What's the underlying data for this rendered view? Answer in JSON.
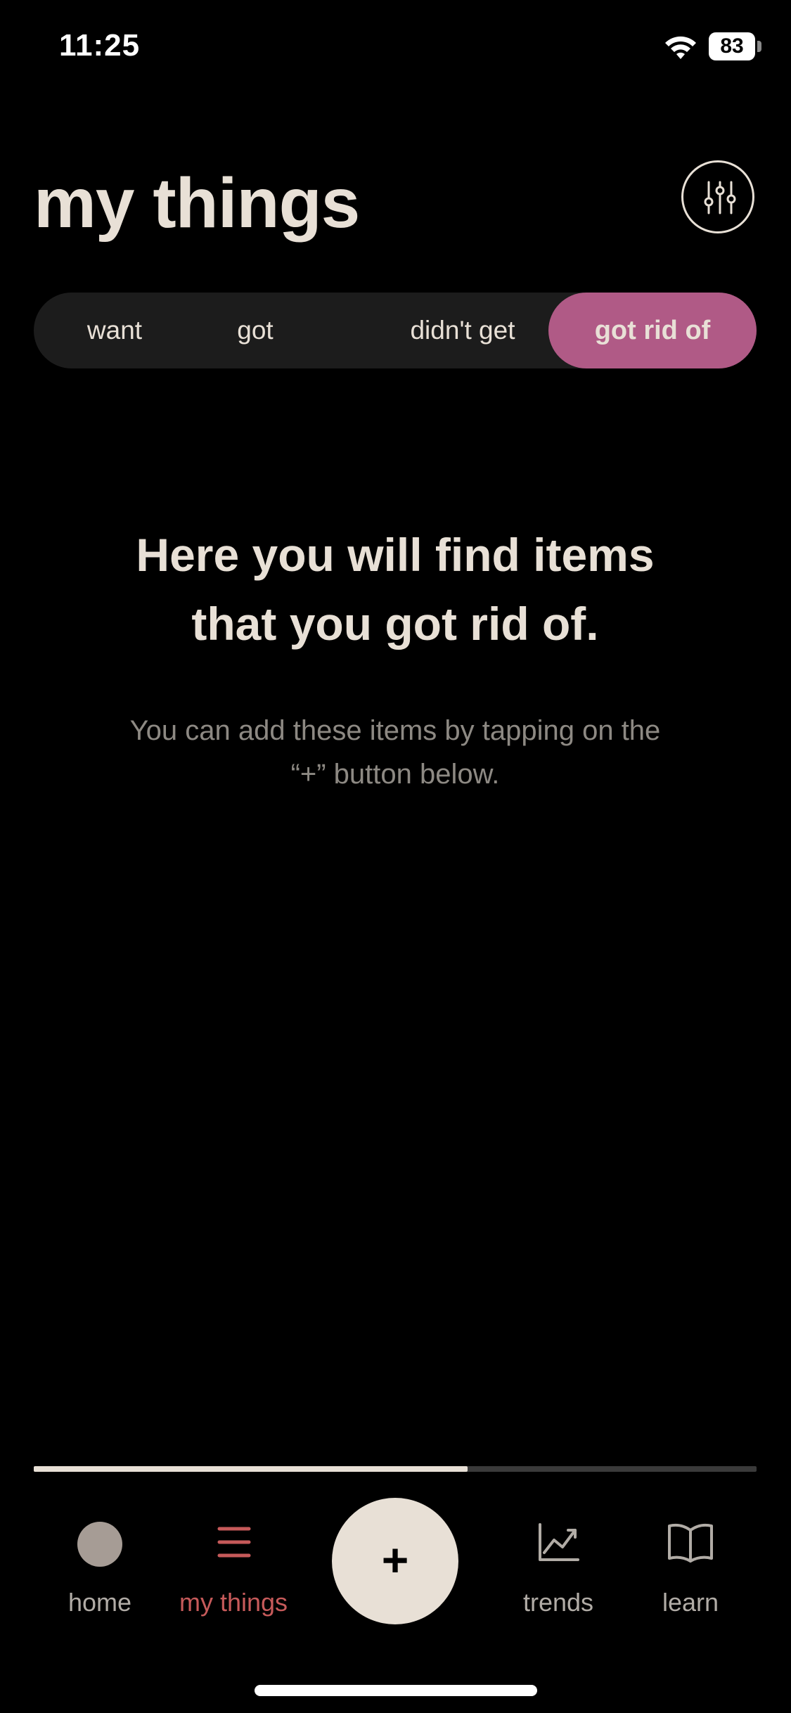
{
  "status_bar": {
    "time": "11:25",
    "battery": "83"
  },
  "header": {
    "title": "my things",
    "filter_icon": "sliders-icon"
  },
  "tabs": [
    {
      "label": "want",
      "active": false
    },
    {
      "label": "got",
      "active": false
    },
    {
      "label": "didn't get",
      "active": false
    },
    {
      "label": "got rid of",
      "active": true
    }
  ],
  "empty_state": {
    "title_line1": "Here you will find items",
    "title_line2": "that you got rid of.",
    "subtitle_line1": "You can add these items by tapping on the",
    "subtitle_line2": "“+” button below."
  },
  "progress": {
    "fraction": 0.6
  },
  "bottom_nav": {
    "items": [
      {
        "label": "home",
        "icon": "avatar-icon",
        "active": false
      },
      {
        "label": "my things",
        "icon": "list-icon",
        "active": true
      },
      {
        "label": "trends",
        "icon": "trend-chart-icon",
        "active": false
      },
      {
        "label": "learn",
        "icon": "book-icon",
        "active": false
      }
    ],
    "add_label": "+"
  },
  "colors": {
    "background": "#000000",
    "text_primary": "#e8e0d6",
    "text_secondary": "#8d8983",
    "accent_tab": "#b05a86",
    "nav_active": "#c65a5a",
    "nav_inactive": "#b1aca6"
  }
}
